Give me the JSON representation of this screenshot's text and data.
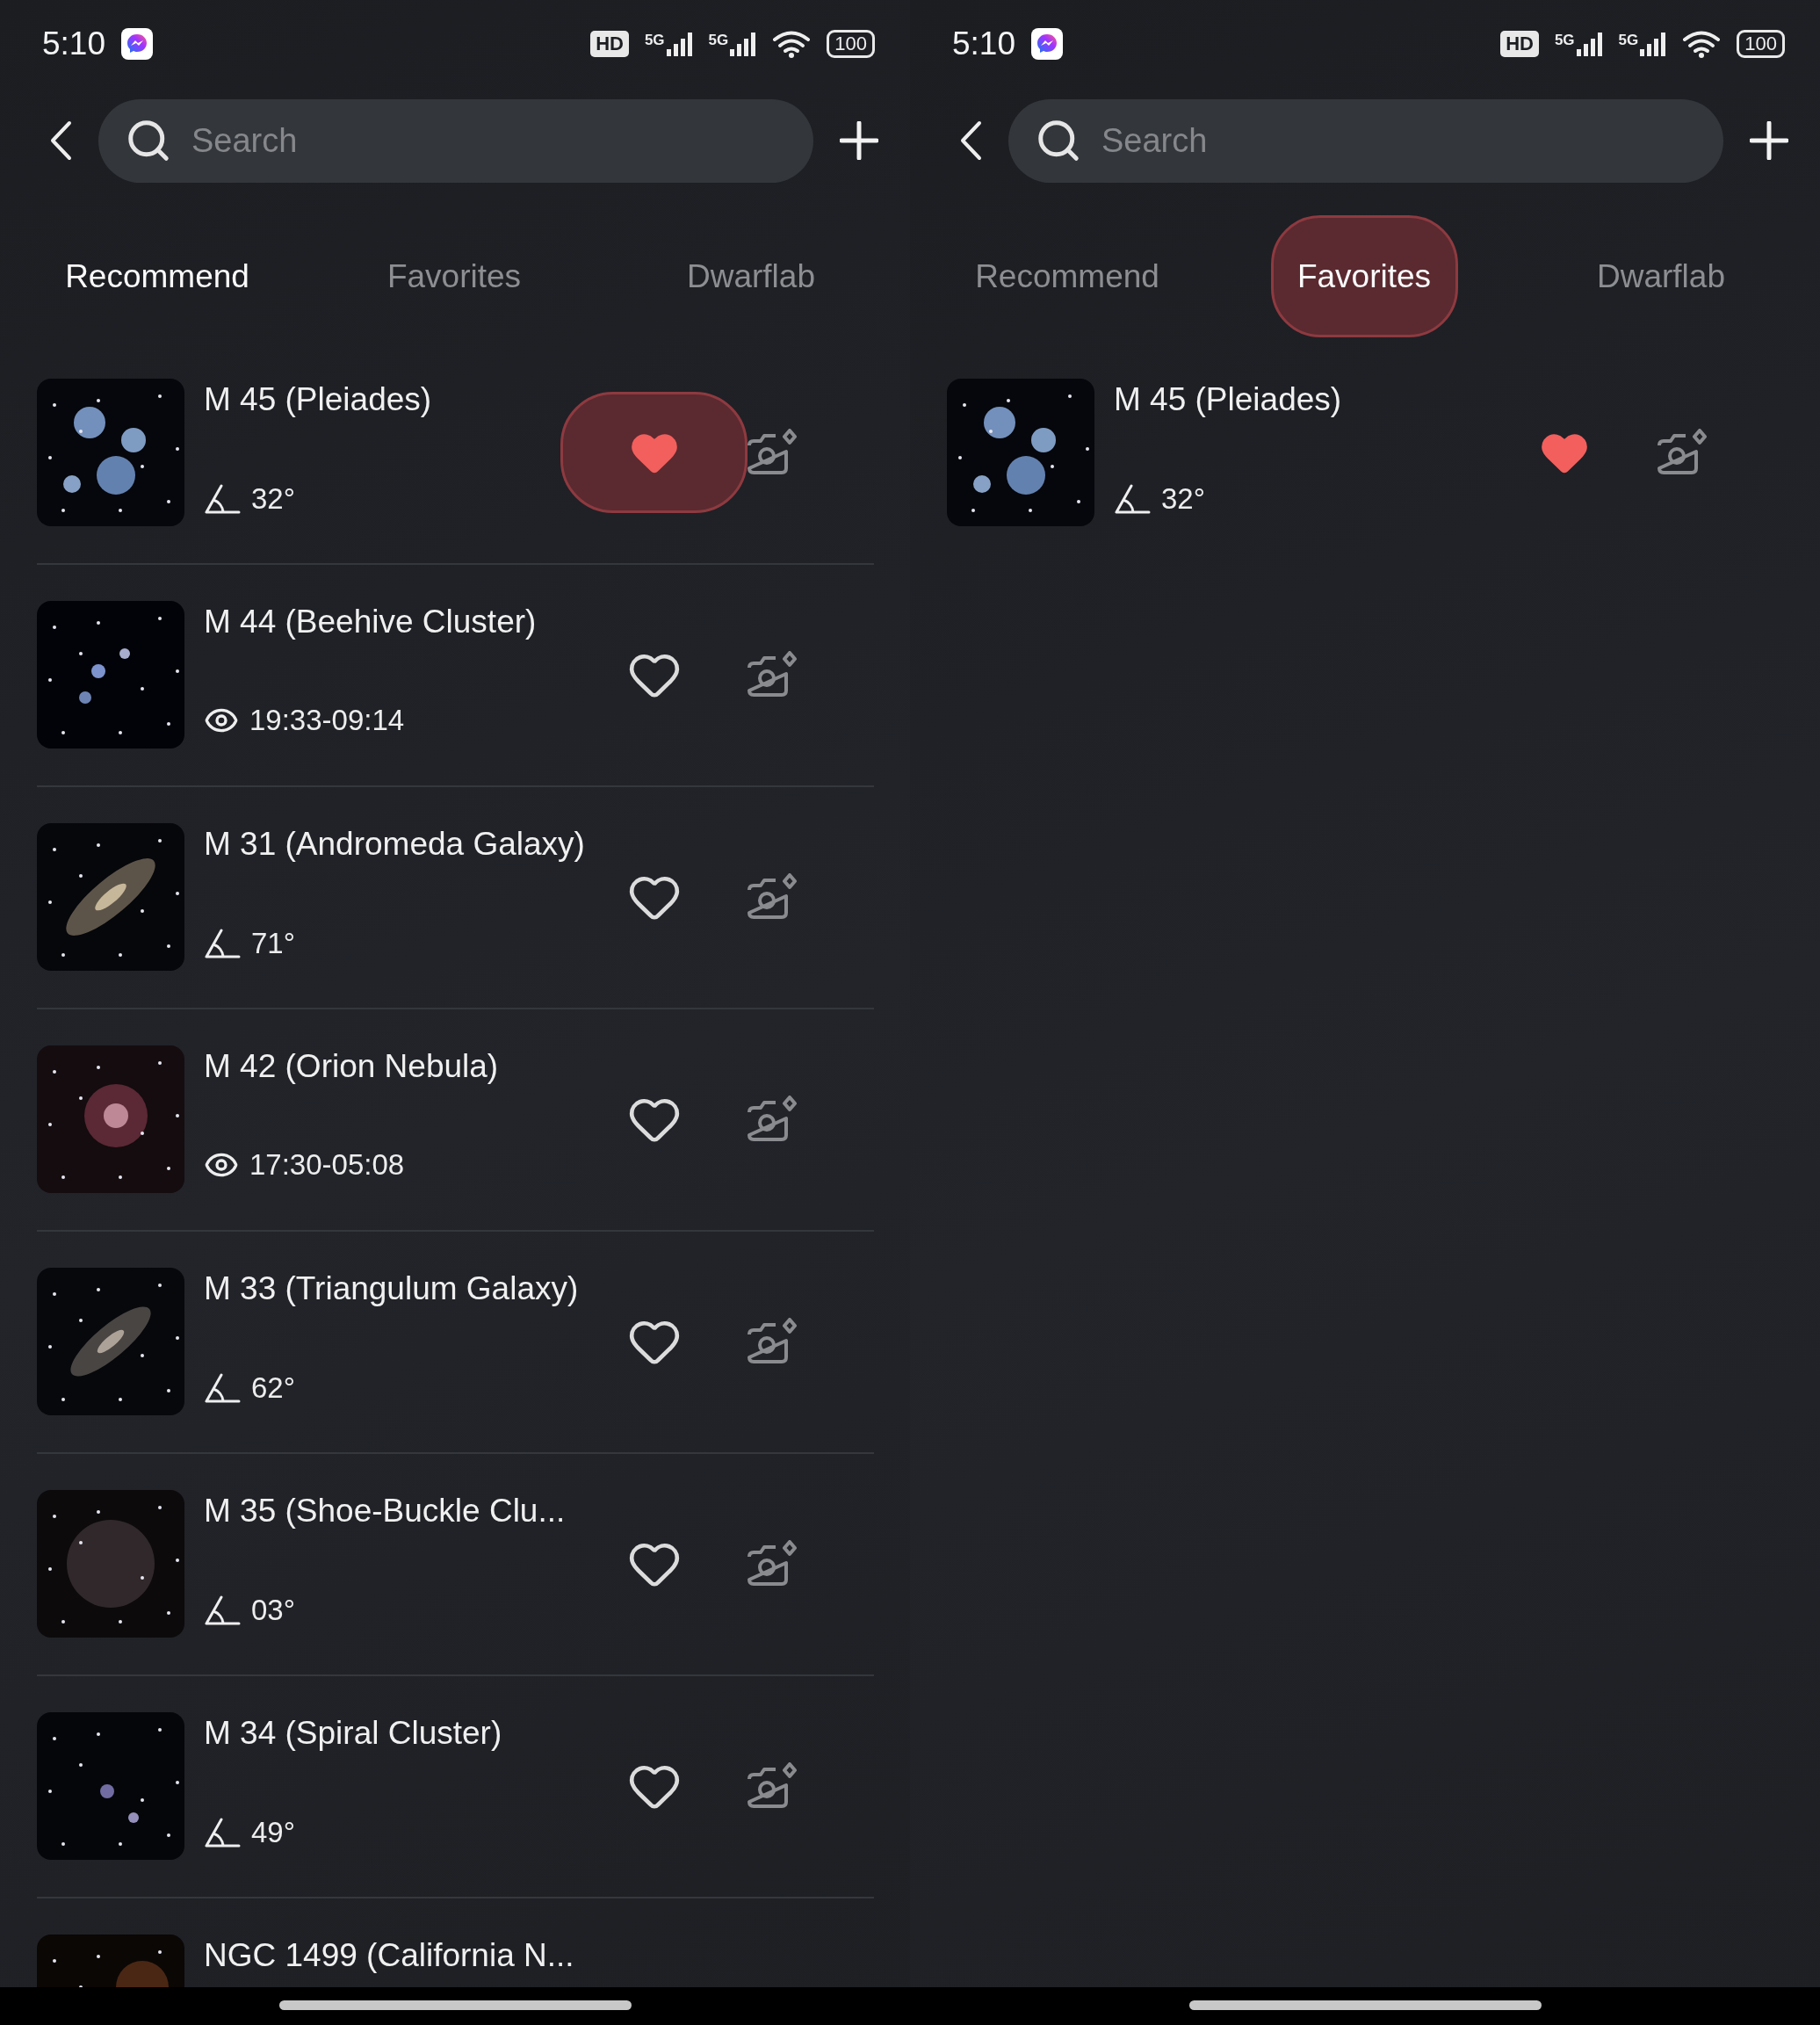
{
  "phones": [
    {
      "status_bar": {
        "time": "5:10",
        "hd": "HD",
        "networks": [
          "5G",
          "5G"
        ],
        "battery": "100"
      },
      "search": {
        "placeholder": "Search"
      },
      "tabs": [
        {
          "label": "Recommend",
          "selected": true,
          "pressed": false
        },
        {
          "label": "Favorites",
          "selected": false,
          "pressed": false
        },
        {
          "label": "Dwarflab",
          "selected": false,
          "pressed": false
        }
      ],
      "objects": [
        {
          "name": "M 45 (Pleiades)",
          "kind": "altitude",
          "reading": "32°",
          "favorite": true,
          "pressed": true
        },
        {
          "name": "M 44 (Beehive Cluster)",
          "kind": "visible",
          "reading": "19:33-09:14",
          "favorite": false,
          "pressed": false
        },
        {
          "name": "M 31 (Andromeda Galaxy)",
          "kind": "altitude",
          "reading": "71°",
          "favorite": false,
          "pressed": false
        },
        {
          "name": "M 42 (Orion Nebula)",
          "kind": "visible",
          "reading": "17:30-05:08",
          "favorite": false,
          "pressed": false
        },
        {
          "name": "M 33 (Triangulum Galaxy)",
          "kind": "altitude",
          "reading": "62°",
          "favorite": false,
          "pressed": false
        },
        {
          "name": "M 35 (Shoe-Buckle Clu...",
          "kind": "altitude",
          "reading": "03°",
          "favorite": false,
          "pressed": false
        },
        {
          "name": "M 34 (Spiral Cluster)",
          "kind": "altitude",
          "reading": "49°",
          "favorite": false,
          "pressed": false
        },
        {
          "name": "NGC 1499 (California N..."
        }
      ]
    },
    {
      "status_bar": {
        "time": "5:10",
        "hd": "HD",
        "networks": [
          "5G",
          "5G"
        ],
        "battery": "100"
      },
      "search": {
        "placeholder": "Search"
      },
      "tabs": [
        {
          "label": "Recommend",
          "selected": false,
          "pressed": false
        },
        {
          "label": "Favorites",
          "selected": true,
          "pressed": true
        },
        {
          "label": "Dwarflab",
          "selected": false,
          "pressed": false
        }
      ],
      "objects": [
        {
          "name": "M 45 (Pleiades)",
          "kind": "altitude",
          "reading": "32°",
          "favorite": true,
          "pressed": false
        }
      ]
    }
  ]
}
